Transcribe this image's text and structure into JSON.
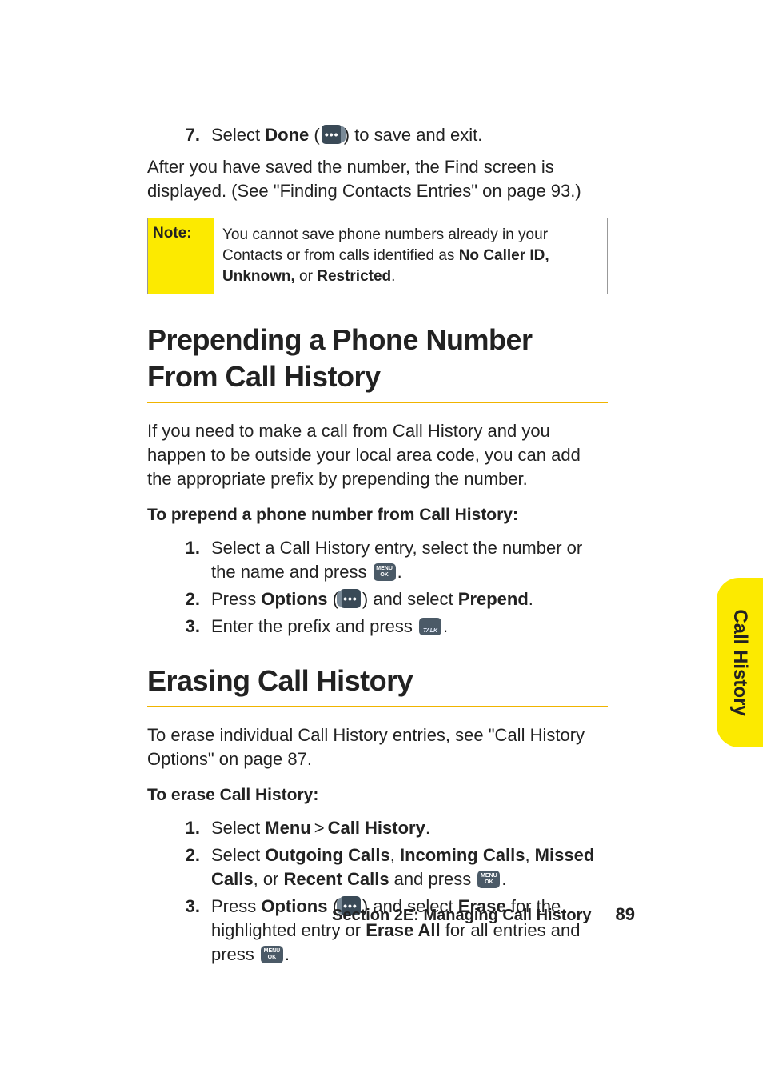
{
  "step7": {
    "num": "7.",
    "pre": "Select ",
    "bold": "Done",
    "post_open": " (",
    "post_close": ") to save and exit."
  },
  "after_save": "After you have saved the number, the Find screen is displayed. (See \"Finding Contacts Entries\" on page 93.)",
  "note": {
    "label": "Note:",
    "line1": "You cannot save phone numbers already in your Contacts or from calls identified as ",
    "bold1": "No Caller ID, Unknown,",
    "mid": " or ",
    "bold2": "Restricted",
    "end": "."
  },
  "h1a": "Prepending a Phone Number From Call History",
  "prepend_intro": "If you need to make a call from Call History and you happen to be outside your local area code, you can add the appropriate prefix by prepending the number.",
  "prepend_sub": "To prepend a phone number from Call History:",
  "prepend_steps": {
    "s1": {
      "num": "1.",
      "pre": "Select a Call History entry, select the number or the name and press ",
      "post": "."
    },
    "s2": {
      "num": "2.",
      "pre": "Press ",
      "b1": "Options",
      "mid1": " (",
      "mid2": ") and select ",
      "b2": "Prepend",
      "end": "."
    },
    "s3": {
      "num": "3.",
      "pre": "Enter the prefix and press ",
      "post": "."
    }
  },
  "h1b": "Erasing Call History",
  "erase_intro": "To erase individual Call History entries, see \"Call History Options\" on page 87.",
  "erase_sub": "To erase Call History:",
  "erase_steps": {
    "s1": {
      "num": "1.",
      "pre": "Select ",
      "b1": "Menu",
      "gt": ">",
      "b2": "Call History",
      "end": "."
    },
    "s2": {
      "num": "2.",
      "pre": "Select ",
      "b1": "Outgoing Calls",
      "c1": ", ",
      "b2": "Incoming Calls",
      "c2": ", ",
      "b3": "Missed Calls",
      "c3": ", or ",
      "b4": "Recent Calls",
      "mid": " and press ",
      "end": "."
    },
    "s3": {
      "num": "3.",
      "pre": "Press ",
      "b1": "Options",
      "p1": " (",
      "p2": ") and select ",
      "b2": "Erase",
      "mid": " for the highlighted entry or ",
      "b3": "Erase All",
      "mid2": " for all entries and press ",
      "end": "."
    }
  },
  "side_tab": "Call History",
  "footer": {
    "title": "Section 2E: Managing Call History",
    "page": "89"
  }
}
